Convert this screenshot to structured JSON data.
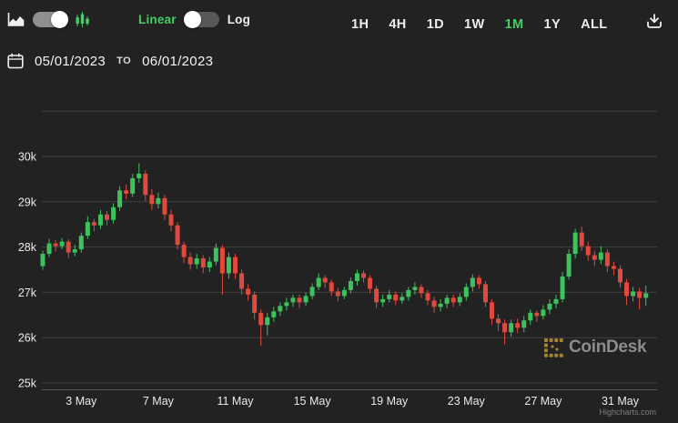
{
  "toolbar": {
    "chart_type": {
      "area_icon": "area-chart",
      "candle_icon": "candlestick-bars",
      "selected": "candlestick"
    },
    "scale": {
      "linear_label": "Linear",
      "log_label": "Log",
      "selected": "Linear"
    },
    "ranges": [
      {
        "label": "1H",
        "active": false
      },
      {
        "label": "4H",
        "active": false
      },
      {
        "label": "1D",
        "active": false
      },
      {
        "label": "1W",
        "active": false
      },
      {
        "label": "1M",
        "active": true
      },
      {
        "label": "1Y",
        "active": false
      },
      {
        "label": "ALL",
        "active": false
      }
    ],
    "download_icon": "download"
  },
  "date_range": {
    "start": "05/01/2023",
    "separator": "TO",
    "end": "06/01/2023"
  },
  "watermark": {
    "brand": "CoinDesk"
  },
  "credit": "Highcharts.com",
  "colors": {
    "background": "#212221",
    "grid": "#3f3f3f",
    "axis_line": "#5a5a5a",
    "tick_text": "#e9e9e9",
    "candle_up": "#3ec25e",
    "candle_down": "#e04a3e",
    "accent_green": "#45cd63",
    "watermark_text": "#969696",
    "watermark_icon": "#b08d2e"
  },
  "chart_data": {
    "type": "candlestick",
    "title": "",
    "xlabel": "",
    "ylabel": "",
    "x_range": [
      "05/01/2023",
      "06/01/2023"
    ],
    "ylim_k": [
      24.8,
      31.0
    ],
    "grid": true,
    "candles_per_day": 3,
    "start_day": 1,
    "y_gridlines_k": [
      31,
      30,
      29,
      28,
      27,
      26,
      25
    ],
    "y_ticks": [
      {
        "value": 30,
        "label": "30k"
      },
      {
        "value": 29,
        "label": "29k"
      },
      {
        "value": 28,
        "label": "28k"
      },
      {
        "value": 27,
        "label": "27k"
      },
      {
        "value": 26,
        "label": "26k"
      },
      {
        "value": 25,
        "label": "25k"
      }
    ],
    "x_ticks": [
      {
        "day": 3,
        "label": "3 May"
      },
      {
        "day": 7,
        "label": "7 May"
      },
      {
        "day": 11,
        "label": "11 May"
      },
      {
        "day": 15,
        "label": "15 May"
      },
      {
        "day": 19,
        "label": "19 May"
      },
      {
        "day": 23,
        "label": "23 May"
      },
      {
        "day": 27,
        "label": "27 May"
      },
      {
        "day": 31,
        "label": "31 May"
      }
    ],
    "ohlc_k": [
      [
        27.58,
        27.92,
        27.5,
        27.85
      ],
      [
        27.85,
        28.18,
        27.78,
        28.08
      ],
      [
        28.08,
        28.15,
        27.9,
        28.02
      ],
      [
        28.02,
        28.2,
        27.95,
        28.12
      ],
      [
        28.12,
        28.17,
        27.76,
        27.88
      ],
      [
        27.88,
        28.05,
        27.8,
        27.95
      ],
      [
        27.95,
        28.32,
        27.88,
        28.25
      ],
      [
        28.25,
        28.68,
        28.18,
        28.55
      ],
      [
        28.55,
        28.62,
        28.35,
        28.48
      ],
      [
        28.48,
        28.82,
        28.4,
        28.72
      ],
      [
        28.72,
        28.8,
        28.48,
        28.6
      ],
      [
        28.6,
        28.97,
        28.52,
        28.88
      ],
      [
        28.88,
        29.34,
        28.8,
        29.25
      ],
      [
        29.25,
        29.38,
        29.05,
        29.18
      ],
      [
        29.18,
        29.62,
        29.1,
        29.52
      ],
      [
        29.52,
        29.85,
        29.42,
        29.62
      ],
      [
        29.62,
        29.7,
        29.02,
        29.15
      ],
      [
        29.15,
        29.28,
        28.82,
        28.95
      ],
      [
        28.95,
        29.2,
        28.85,
        29.08
      ],
      [
        29.08,
        29.15,
        28.6,
        28.72
      ],
      [
        28.72,
        28.82,
        28.35,
        28.48
      ],
      [
        28.48,
        28.55,
        27.95,
        28.05
      ],
      [
        28.05,
        28.12,
        27.65,
        27.78
      ],
      [
        27.78,
        27.88,
        27.5,
        27.62
      ],
      [
        27.62,
        27.85,
        27.52,
        27.75
      ],
      [
        27.75,
        27.82,
        27.42,
        27.55
      ],
      [
        27.55,
        27.78,
        27.45,
        27.68
      ],
      [
        27.68,
        28.08,
        27.6,
        27.98
      ],
      [
        27.98,
        28.05,
        26.95,
        27.42
      ],
      [
        27.42,
        27.88,
        27.3,
        27.78
      ],
      [
        27.78,
        27.85,
        27.3,
        27.42
      ],
      [
        27.42,
        27.5,
        26.95,
        27.08
      ],
      [
        27.08,
        27.18,
        26.82,
        26.95
      ],
      [
        26.95,
        27.02,
        26.4,
        26.55
      ],
      [
        26.55,
        26.62,
        25.82,
        26.28
      ],
      [
        26.28,
        26.55,
        26.05,
        26.45
      ],
      [
        26.45,
        26.68,
        26.35,
        26.58
      ],
      [
        26.58,
        26.78,
        26.48,
        26.7
      ],
      [
        26.7,
        26.88,
        26.6,
        26.78
      ],
      [
        26.78,
        26.95,
        26.68,
        26.88
      ],
      [
        26.88,
        26.95,
        26.66,
        26.78
      ],
      [
        26.78,
        27.0,
        26.7,
        26.92
      ],
      [
        26.92,
        27.2,
        26.85,
        27.12
      ],
      [
        27.12,
        27.42,
        27.05,
        27.32
      ],
      [
        27.32,
        27.38,
        27.1,
        27.22
      ],
      [
        27.22,
        27.28,
        26.92,
        27.02
      ],
      [
        27.02,
        27.1,
        26.8,
        26.92
      ],
      [
        26.92,
        27.12,
        26.85,
        27.05
      ],
      [
        27.05,
        27.33,
        26.98,
        27.25
      ],
      [
        27.25,
        27.5,
        27.15,
        27.42
      ],
      [
        27.42,
        27.48,
        27.22,
        27.32
      ],
      [
        27.32,
        27.38,
        26.98,
        27.08
      ],
      [
        27.08,
        27.15,
        26.65,
        26.78
      ],
      [
        26.78,
        26.95,
        26.68,
        26.85
      ],
      [
        26.85,
        27.05,
        26.78,
        26.95
      ],
      [
        26.95,
        27.02,
        26.72,
        26.82
      ],
      [
        26.82,
        26.98,
        26.75,
        26.9
      ],
      [
        26.9,
        27.12,
        26.82,
        27.05
      ],
      [
        27.05,
        27.22,
        26.95,
        27.12
      ],
      [
        27.12,
        27.18,
        26.88,
        26.98
      ],
      [
        26.98,
        27.05,
        26.72,
        26.82
      ],
      [
        26.82,
        26.9,
        26.55,
        26.68
      ],
      [
        26.68,
        26.85,
        26.58,
        26.75
      ],
      [
        26.75,
        26.95,
        26.65,
        26.88
      ],
      [
        26.88,
        26.95,
        26.68,
        26.78
      ],
      [
        26.78,
        26.98,
        26.7,
        26.9
      ],
      [
        26.9,
        27.2,
        26.82,
        27.12
      ],
      [
        27.12,
        27.4,
        27.02,
        27.32
      ],
      [
        27.32,
        27.38,
        27.08,
        27.18
      ],
      [
        27.18,
        27.25,
        26.68,
        26.78
      ],
      [
        26.78,
        26.85,
        26.28,
        26.42
      ],
      [
        26.42,
        26.52,
        26.15,
        26.32
      ],
      [
        26.32,
        26.4,
        25.85,
        26.12
      ],
      [
        26.12,
        26.4,
        26.02,
        26.32
      ],
      [
        26.32,
        26.42,
        26.1,
        26.22
      ],
      [
        26.22,
        26.48,
        26.12,
        26.38
      ],
      [
        26.38,
        26.62,
        26.28,
        26.55
      ],
      [
        26.55,
        26.6,
        26.35,
        26.48
      ],
      [
        26.48,
        26.72,
        26.4,
        26.62
      ],
      [
        26.62,
        26.85,
        26.52,
        26.75
      ],
      [
        26.75,
        26.95,
        26.65,
        26.85
      ],
      [
        26.85,
        27.45,
        26.78,
        27.35
      ],
      [
        27.35,
        27.95,
        27.28,
        27.85
      ],
      [
        27.85,
        28.4,
        27.75,
        28.32
      ],
      [
        28.32,
        28.45,
        27.92,
        28.02
      ],
      [
        28.02,
        28.12,
        27.7,
        27.82
      ],
      [
        27.82,
        27.92,
        27.58,
        27.72
      ],
      [
        27.72,
        28.02,
        27.62,
        27.88
      ],
      [
        27.88,
        27.95,
        27.45,
        27.58
      ],
      [
        27.58,
        27.68,
        27.38,
        27.52
      ],
      [
        27.52,
        27.6,
        27.1,
        27.22
      ],
      [
        27.22,
        27.3,
        26.72,
        26.92
      ],
      [
        26.92,
        27.12,
        26.8,
        27.02
      ],
      [
        27.02,
        27.1,
        26.62,
        26.88
      ],
      [
        26.88,
        27.15,
        26.7,
        26.98
      ]
    ]
  }
}
